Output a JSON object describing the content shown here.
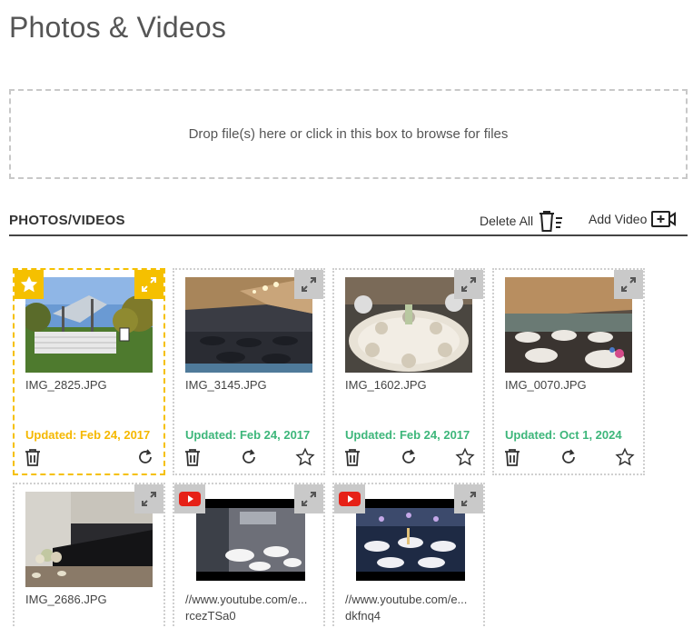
{
  "page": {
    "title": "Photos & Videos"
  },
  "dropzone": {
    "text": "Drop file(s) here or click in this box to browse for files"
  },
  "section": {
    "title": "PHOTOS/VIDEOS",
    "delete_all_label": "Delete All",
    "add_video_label": "Add Video"
  },
  "colors": {
    "featured": "#f5c000",
    "updated_green": "#3db67a",
    "updated_yellow": "#f5b800",
    "youtube_red": "#e62117"
  },
  "items": [
    {
      "name": "IMG_2825.JPG",
      "updated": "Updated: Feb 24, 2017",
      "featured": true,
      "type": "photo"
    },
    {
      "name": "IMG_3145.JPG",
      "updated": "Updated: Feb 24, 2017",
      "featured": false,
      "type": "photo"
    },
    {
      "name": "IMG_1602.JPG",
      "updated": "Updated: Feb 24, 2017",
      "featured": false,
      "type": "photo"
    },
    {
      "name": "IMG_0070.JPG",
      "updated": "Updated: Oct 1, 2024",
      "featured": false,
      "type": "photo"
    },
    {
      "name": "IMG_2686.JPG",
      "type": "photo"
    },
    {
      "name": "//www.youtube.com/e...",
      "name2": "rcezTSa0",
      "type": "video"
    },
    {
      "name": "//www.youtube.com/e...",
      "name2": "dkfnq4",
      "type": "video"
    }
  ]
}
